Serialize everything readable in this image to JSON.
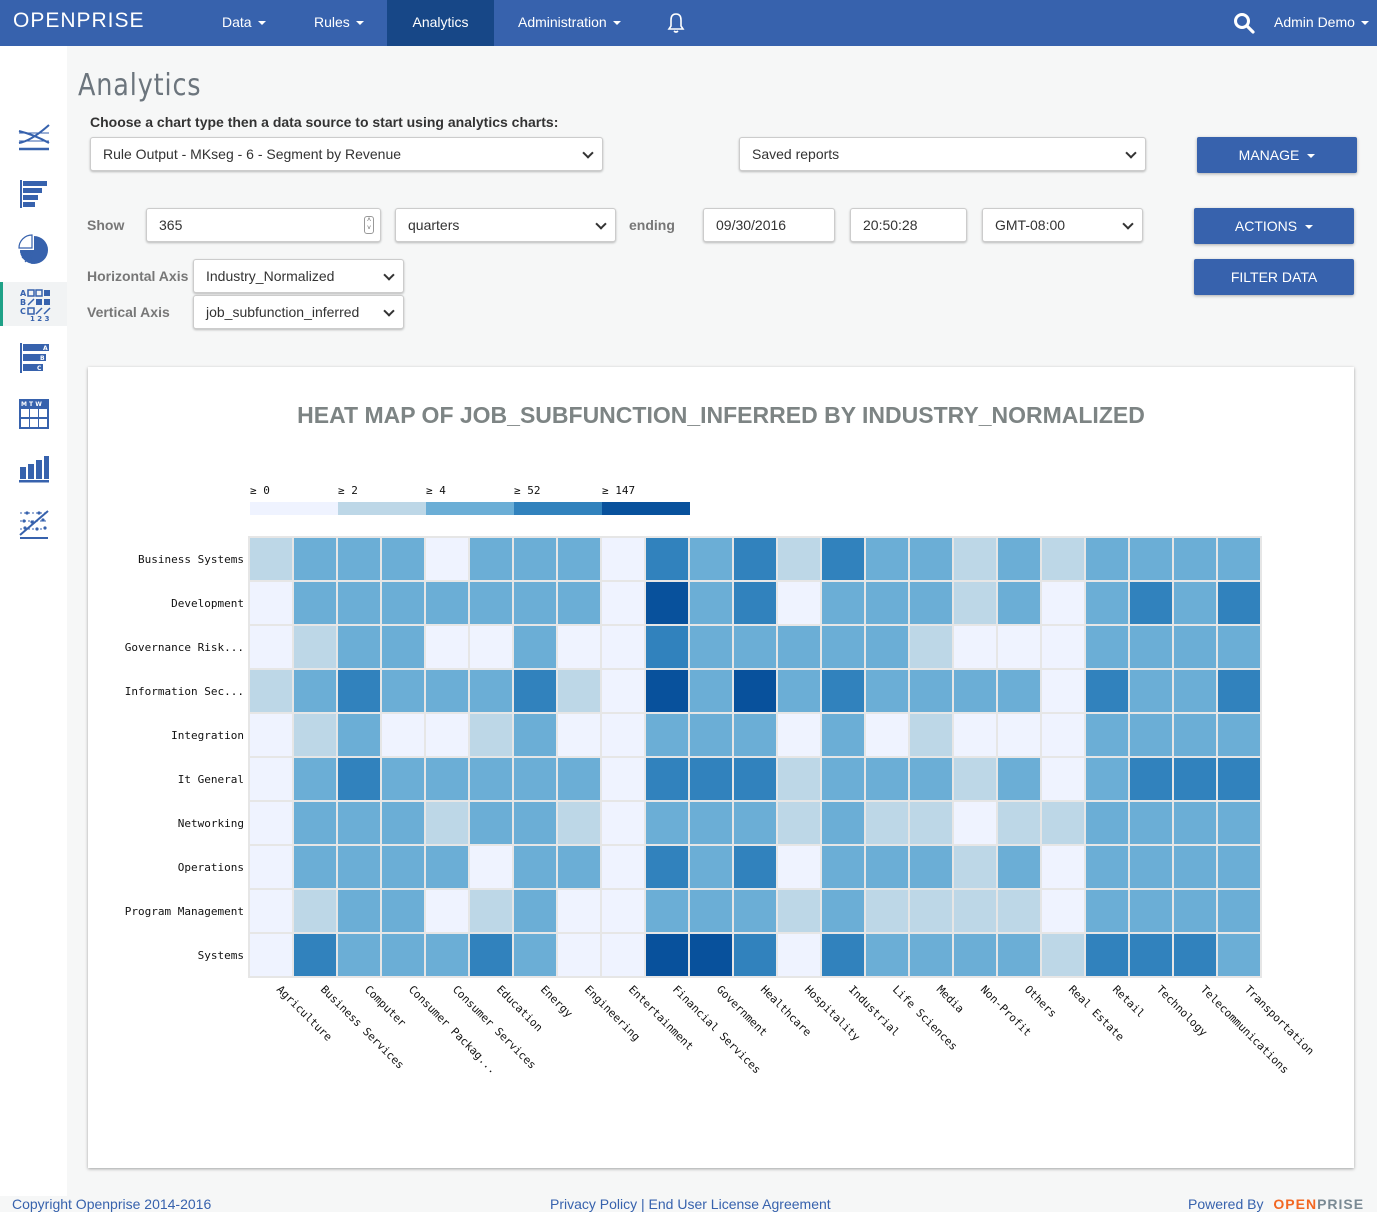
{
  "topnav": {
    "logo": "OPENPRISE",
    "items": [
      {
        "label": "Data",
        "dropdown": true
      },
      {
        "label": "Rules",
        "dropdown": true
      },
      {
        "label": "Analytics",
        "dropdown": false,
        "active": true
      },
      {
        "label": "Administration",
        "dropdown": true
      }
    ],
    "user": "Admin Demo",
    "icons": [
      "bell-icon",
      "search-icon"
    ]
  },
  "sidebar": {
    "items": [
      {
        "name": "line-chart",
        "active": false
      },
      {
        "name": "bar-chart-horizontal",
        "active": false
      },
      {
        "name": "pie-chart",
        "active": false
      },
      {
        "name": "heat-map",
        "active": true
      },
      {
        "name": "labeled-bar-chart",
        "active": false
      },
      {
        "name": "calendar-chart",
        "active": false
      },
      {
        "name": "column-chart",
        "active": false
      },
      {
        "name": "scatter-chart",
        "active": false
      }
    ]
  },
  "page": {
    "title": "Analytics",
    "instructions": "Choose a chart type then a data source to start using analytics charts:",
    "data_source": "Rule Output - MKseg - 6 - Segment by Revenue",
    "saved_reports": "Saved reports",
    "manage_label": "MANAGE",
    "show_label": "Show",
    "show_value": "365",
    "period": "quarters",
    "ending_label": "ending",
    "end_date": "09/30/2016",
    "end_time": "20:50:28",
    "timezone": "GMT-08:00",
    "actions_label": "ACTIONS",
    "filter_label": "FILTER DATA",
    "h_axis_label": "Horizontal Axis",
    "h_axis_value": "Industry_Normalized",
    "v_axis_label": "Vertical Axis",
    "v_axis_value": "job_subfunction_inferred"
  },
  "chart_data": {
    "type": "heatmap",
    "title": "HEAT MAP OF JOB_SUBFUNCTION_INFERRED BY INDUSTRY_NORMALIZED",
    "xlabel": "Industry_Normalized",
    "ylabel": "job_subfunction_inferred",
    "legend": {
      "position": "top-left",
      "thresholds": [
        "≥ 0",
        "≥ 2",
        "≥ 4",
        "≥ 52",
        "≥ 147"
      ],
      "colors": [
        "#eff3ff",
        "#bdd7e7",
        "#6baed6",
        "#3182bd",
        "#08519c"
      ]
    },
    "x": [
      "Agriculture",
      "Business Services",
      "Computer",
      "Consumer Packag...",
      "Consumer Services",
      "Education",
      "Energy",
      "Engineering",
      "Entertainment",
      "Financial Services",
      "Government",
      "Healthcare",
      "Hospitality",
      "Industrial",
      "Life Sciences",
      "Media",
      "Non-Profit",
      "Others",
      "Real Estate",
      "Retail",
      "Technology",
      "Telecommunications",
      "Transportation"
    ],
    "y": [
      "Business Systems",
      "Development",
      "Governance Risk...",
      "Information Sec...",
      "Integration",
      "It General",
      "Networking",
      "Operations",
      "Program Management",
      "Systems"
    ],
    "levels_note": "values are legend bucket indices 0-4 (≥0, ≥2, ≥4, ≥52, ≥147)",
    "levels": [
      [
        1,
        2,
        2,
        2,
        0,
        2,
        2,
        2,
        0,
        3,
        2,
        3,
        1,
        3,
        2,
        2,
        1,
        2,
        1,
        2,
        2,
        2,
        2
      ],
      [
        0,
        2,
        2,
        2,
        2,
        2,
        2,
        2,
        0,
        4,
        2,
        3,
        0,
        2,
        2,
        2,
        1,
        2,
        0,
        2,
        3,
        2,
        3
      ],
      [
        0,
        1,
        2,
        2,
        0,
        0,
        2,
        0,
        0,
        3,
        2,
        2,
        2,
        2,
        2,
        1,
        0,
        0,
        0,
        2,
        2,
        2,
        2
      ],
      [
        1,
        2,
        3,
        2,
        2,
        2,
        3,
        1,
        0,
        4,
        2,
        4,
        2,
        3,
        2,
        2,
        2,
        2,
        0,
        3,
        2,
        2,
        3
      ],
      [
        0,
        1,
        2,
        0,
        0,
        1,
        2,
        0,
        0,
        2,
        2,
        2,
        0,
        2,
        0,
        1,
        0,
        0,
        0,
        2,
        2,
        2,
        2
      ],
      [
        0,
        2,
        3,
        2,
        2,
        2,
        2,
        2,
        0,
        3,
        3,
        3,
        1,
        2,
        2,
        2,
        1,
        2,
        0,
        2,
        3,
        3,
        3
      ],
      [
        0,
        2,
        2,
        2,
        1,
        2,
        2,
        1,
        0,
        2,
        2,
        2,
        1,
        2,
        1,
        1,
        0,
        1,
        1,
        2,
        2,
        2,
        2
      ],
      [
        0,
        2,
        2,
        2,
        2,
        0,
        2,
        2,
        0,
        3,
        2,
        3,
        0,
        2,
        2,
        2,
        1,
        2,
        0,
        2,
        2,
        2,
        2
      ],
      [
        0,
        1,
        2,
        2,
        0,
        1,
        2,
        0,
        0,
        2,
        2,
        2,
        1,
        2,
        1,
        1,
        1,
        1,
        0,
        2,
        2,
        2,
        2
      ],
      [
        0,
        3,
        2,
        2,
        2,
        3,
        2,
        0,
        0,
        4,
        4,
        3,
        0,
        3,
        2,
        2,
        2,
        2,
        1,
        3,
        3,
        3,
        2
      ]
    ]
  },
  "footer": {
    "copyright": "Copyright Openprise 2014-2016",
    "links": "Privacy Policy | End User License Agreement",
    "powered_by": "Powered By",
    "brand_a": "OPEN",
    "brand_b": "PRISE"
  }
}
